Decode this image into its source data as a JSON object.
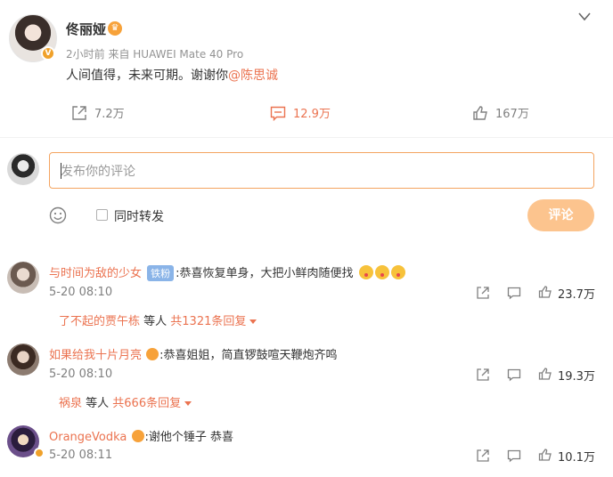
{
  "post": {
    "author": "佟丽娅",
    "meta": "2小时前  来自 HUAWEI Mate 40 Pro",
    "text": "人间值得，未来可期。谢谢你",
    "mention": "@陈思诚",
    "reposts": "7.2万",
    "comments": "12.9万",
    "likes": "167万"
  },
  "composer": {
    "placeholder": "发布你的评论",
    "forward_label": "同时转发",
    "submit_label": "评论"
  },
  "comments": [
    {
      "user": "与时间为敌的少女",
      "badge": "铁粉",
      "text": ":恭喜恢复单身，大把小鲜肉随便找",
      "time": "5-20 08:10",
      "likes": "23.7万",
      "reply_user": "了不起的贾午栋",
      "reply_mid": " 等人 ",
      "reply_count": "共1321条回复"
    },
    {
      "user": "如果给我十片月亮",
      "text": ":恭喜姐姐，简直锣鼓喧天鞭炮齐鸣",
      "time": "5-20 08:10",
      "likes": "19.3万",
      "reply_user": "祸泉",
      "reply_mid": " 等人 ",
      "reply_count": "共666条回复"
    },
    {
      "user": "OrangeVodka",
      "text": ":谢他个锤子 恭喜",
      "time": "5-20 08:11",
      "likes": "10.1万"
    }
  ]
}
